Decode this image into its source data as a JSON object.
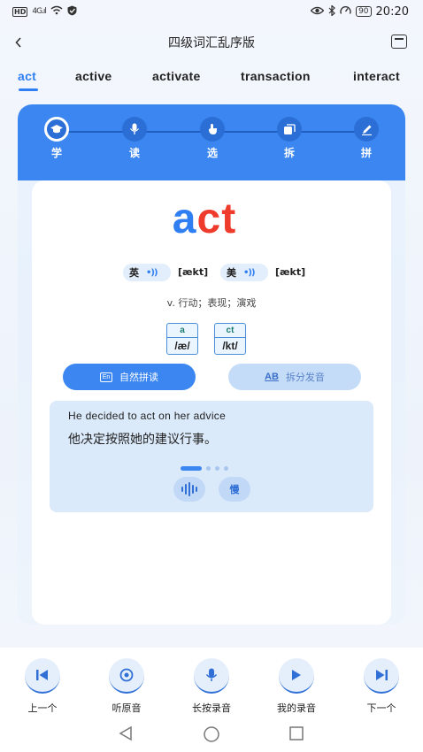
{
  "status_bar": {
    "left_icons": [
      "hd-icon",
      "signal-icon",
      "wifi-icon",
      "shield-icon"
    ],
    "network": "4G",
    "battery": "90",
    "time": "20:20"
  },
  "header": {
    "title": "四级词汇乱序版"
  },
  "tabs": [
    {
      "label": "act",
      "active": true
    },
    {
      "label": "active"
    },
    {
      "label": "activate"
    },
    {
      "label": "transaction"
    },
    {
      "label": "interact"
    }
  ],
  "steps": [
    {
      "label": "学",
      "icon": "graduation-cap-icon",
      "active": true
    },
    {
      "label": "读",
      "icon": "microphone-icon"
    },
    {
      "label": "选",
      "icon": "tap-icon"
    },
    {
      "label": "拆",
      "icon": "cards-icon"
    },
    {
      "label": "拼",
      "icon": "pen-icon"
    }
  ],
  "word": {
    "part1": "a",
    "part2": "ct"
  },
  "pronunciation": {
    "uk_label": "英",
    "uk_ipa": "[ækt]",
    "us_label": "美",
    "us_ipa": "[ækt]"
  },
  "meaning": "v. 行动；表现；演戏",
  "syllables": [
    {
      "spelling": "a",
      "sound": "/æ/"
    },
    {
      "spelling": "ct",
      "sound": "/kt/"
    }
  ],
  "actions": {
    "natural_phonics": "自然拼读",
    "natural_icon": "En",
    "split_phonics": "拆分发音",
    "split_icon": "AB"
  },
  "example": {
    "english": "He decided to act on her advice",
    "chinese": "他决定按照她的建议行事。",
    "slow_label": "慢",
    "page_count": 4,
    "active_page": 1
  },
  "bottom_actions": [
    {
      "label": "上一个",
      "icon": "previous-icon"
    },
    {
      "label": "听原音",
      "icon": "listen-icon"
    },
    {
      "label": "长按录音",
      "icon": "microphone-icon"
    },
    {
      "label": "我的录音",
      "icon": "play-icon"
    },
    {
      "label": "下一个",
      "icon": "next-icon"
    }
  ],
  "colors": {
    "primary": "#3b86f0",
    "word_highlight": "#ef3b2c",
    "card_background": "#eaf3fe"
  }
}
